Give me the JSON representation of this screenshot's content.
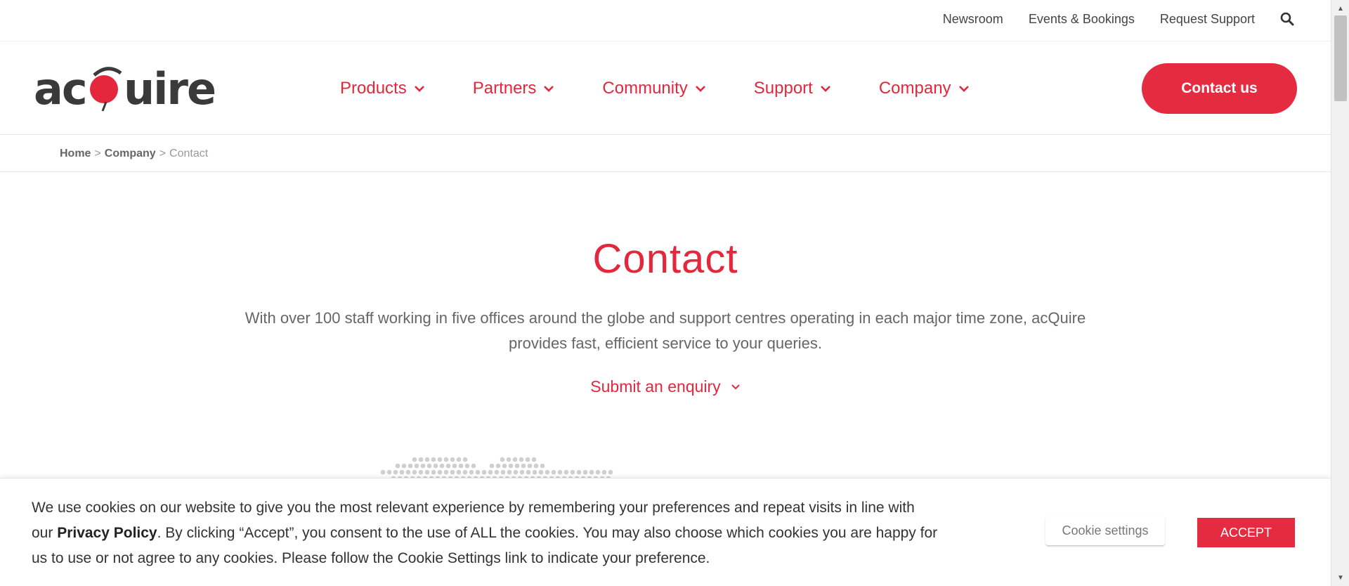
{
  "utility": {
    "links": [
      "Newsroom",
      "Events & Bookings",
      "Request Support"
    ]
  },
  "nav": {
    "logo_text": "acQuire",
    "items": [
      "Products",
      "Partners",
      "Community",
      "Support",
      "Company"
    ],
    "contact_label": "Contact us"
  },
  "breadcrumb": {
    "home": "Home",
    "sep1": ">",
    "company": "Company",
    "sep2": ">",
    "current": "Contact"
  },
  "hero": {
    "title": "Contact",
    "text": "With over 100 staff working in five offices around the globe and support centres operating in each major time zone, acQuire provides fast, efficient service to your queries.",
    "enquiry_label": "Submit an enquiry"
  },
  "cookie": {
    "text_before": "We use cookies on our website to give you the most relevant experience by remembering your preferences and repeat visits in line with our ",
    "policy_label": "Privacy Policy",
    "text_after": ". By clicking “Accept”, you consent to the use of ALL the cookies. You may also choose which cookies you are happy for us to use or not agree to any cookies. Please follow the Cookie Settings link to indicate your preference.",
    "settings_label": "Cookie settings",
    "accept_label": "ACCEPT"
  },
  "colors": {
    "brand_red": "#e4273d",
    "text_gray": "#666666"
  }
}
